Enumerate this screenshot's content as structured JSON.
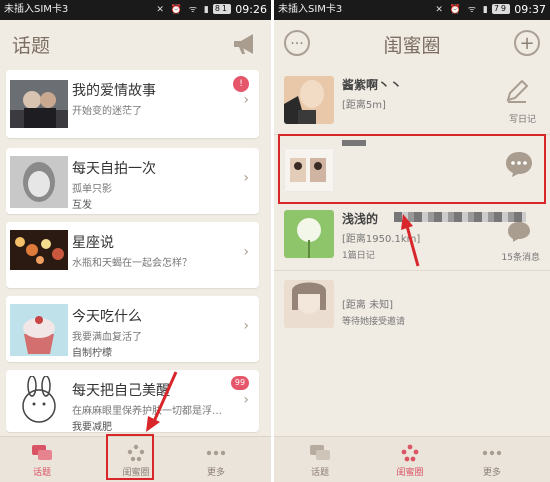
{
  "left": {
    "status": {
      "carrier": "未插入SIM卡3",
      "icons": "✕ ⏰ ᯤ ▮",
      "battery": "81",
      "time": "09:26"
    },
    "title": "话题",
    "cards": [
      {
        "title": "我的爱情故事",
        "sub": "开始变的迷茫了",
        "sub2": "",
        "badge": "!"
      },
      {
        "title": "每天自拍一次",
        "sub": "孤单只影",
        "sub2": "互发",
        "badge": ""
      },
      {
        "title": "星座说",
        "sub": "水瓶和天蝎在一起会怎样？",
        "sub2": "",
        "badge": ""
      },
      {
        "title": "今天吃什么",
        "sub": "我要满血复活了",
        "sub2": "自制柠檬",
        "badge": ""
      },
      {
        "title": "每天把自己美醒",
        "sub": "在麻麻眼里保养护肤一切都是浮…",
        "sub2": "我要减肥",
        "badge": "99"
      }
    ],
    "tabs": [
      {
        "label": "话题"
      },
      {
        "label": "闺蜜圈"
      },
      {
        "label": "更多"
      }
    ]
  },
  "right": {
    "status": {
      "carrier": "未插入SIM卡3",
      "icons": "✕ ⏰ ᯤ ▮",
      "battery": "79",
      "time": "09:37"
    },
    "title": "闺蜜圈",
    "left_btn": "···",
    "right_btn": "+",
    "rows": [
      {
        "name": "酱紫啊丶丶",
        "dist": "[距离5m]",
        "extra": "",
        "action": "写日记"
      },
      {
        "name": "",
        "dist": "",
        "extra": "",
        "action": ""
      },
      {
        "name": "浅浅的",
        "dist": "[距离1950.1km]",
        "extra": "1篇日记",
        "action": "15条消息"
      },
      {
        "name": "",
        "dist": "[距离 未知]",
        "extra": "等待她接受邀请",
        "action": ""
      }
    ],
    "tabs": [
      {
        "label": "话题"
      },
      {
        "label": "闺蜜圈"
      },
      {
        "label": "更多"
      }
    ]
  },
  "colors": {
    "accent": "#d95566",
    "highlight": "#d8262b",
    "background": "#f0ebe3"
  }
}
